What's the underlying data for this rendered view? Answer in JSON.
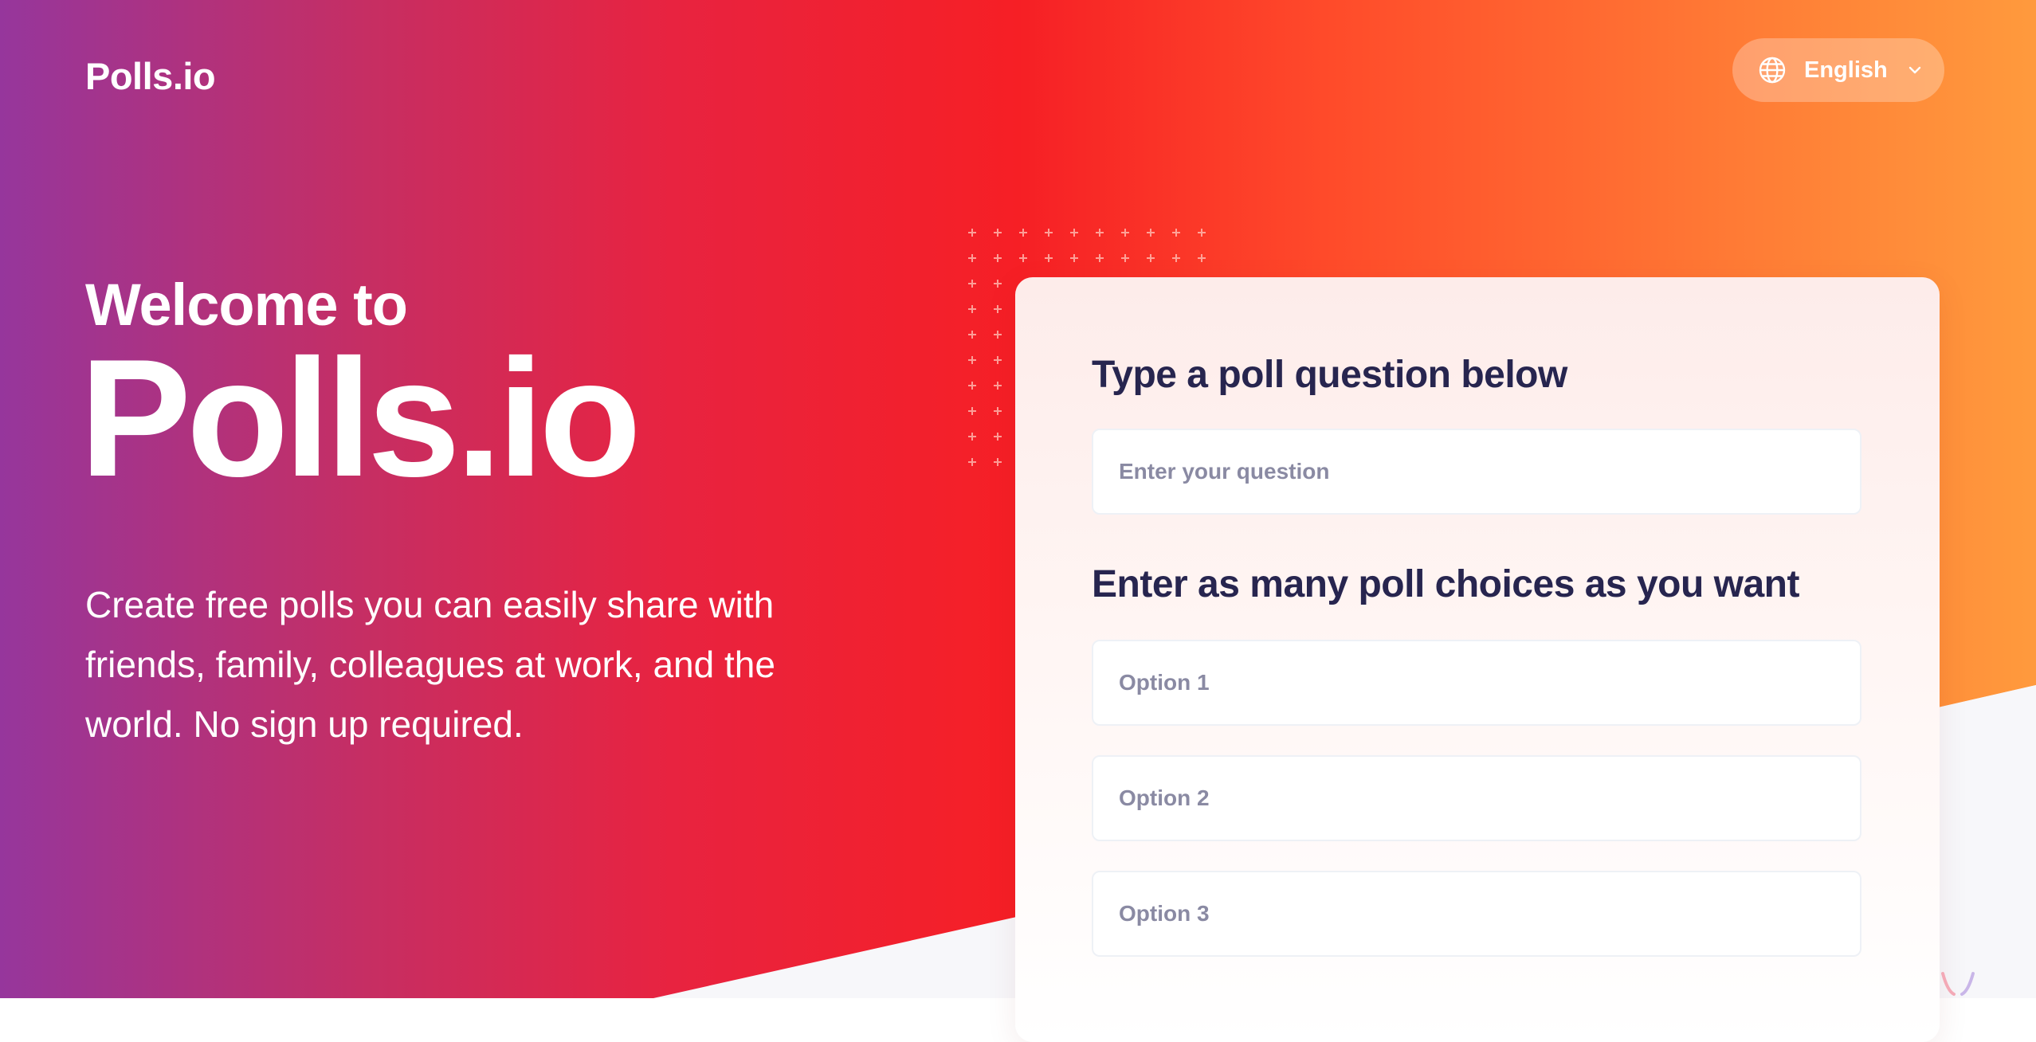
{
  "header": {
    "logo": "Polls.io",
    "language": {
      "label": "English",
      "icon": "globe-icon",
      "caret": "chevron-down-icon"
    }
  },
  "hero": {
    "welcome": "Welcome to",
    "brand": "Polls.io",
    "tagline": "Create free polls you can easily share with friends, family, colleagues at work, and the world. No sign up required."
  },
  "form": {
    "question_heading": "Type a poll question below",
    "question_placeholder": "Enter your question",
    "choices_heading": "Enter as many poll choices as you want",
    "options": [
      {
        "placeholder": "Option 1"
      },
      {
        "placeholder": "Option 2"
      },
      {
        "placeholder": "Option 3"
      }
    ]
  },
  "colors": {
    "gradient_start": "#96369c",
    "gradient_mid": "#f61f25",
    "gradient_end": "#ff9a3d",
    "heading_text": "#27254f",
    "placeholder_text": "#8a8aa3"
  }
}
